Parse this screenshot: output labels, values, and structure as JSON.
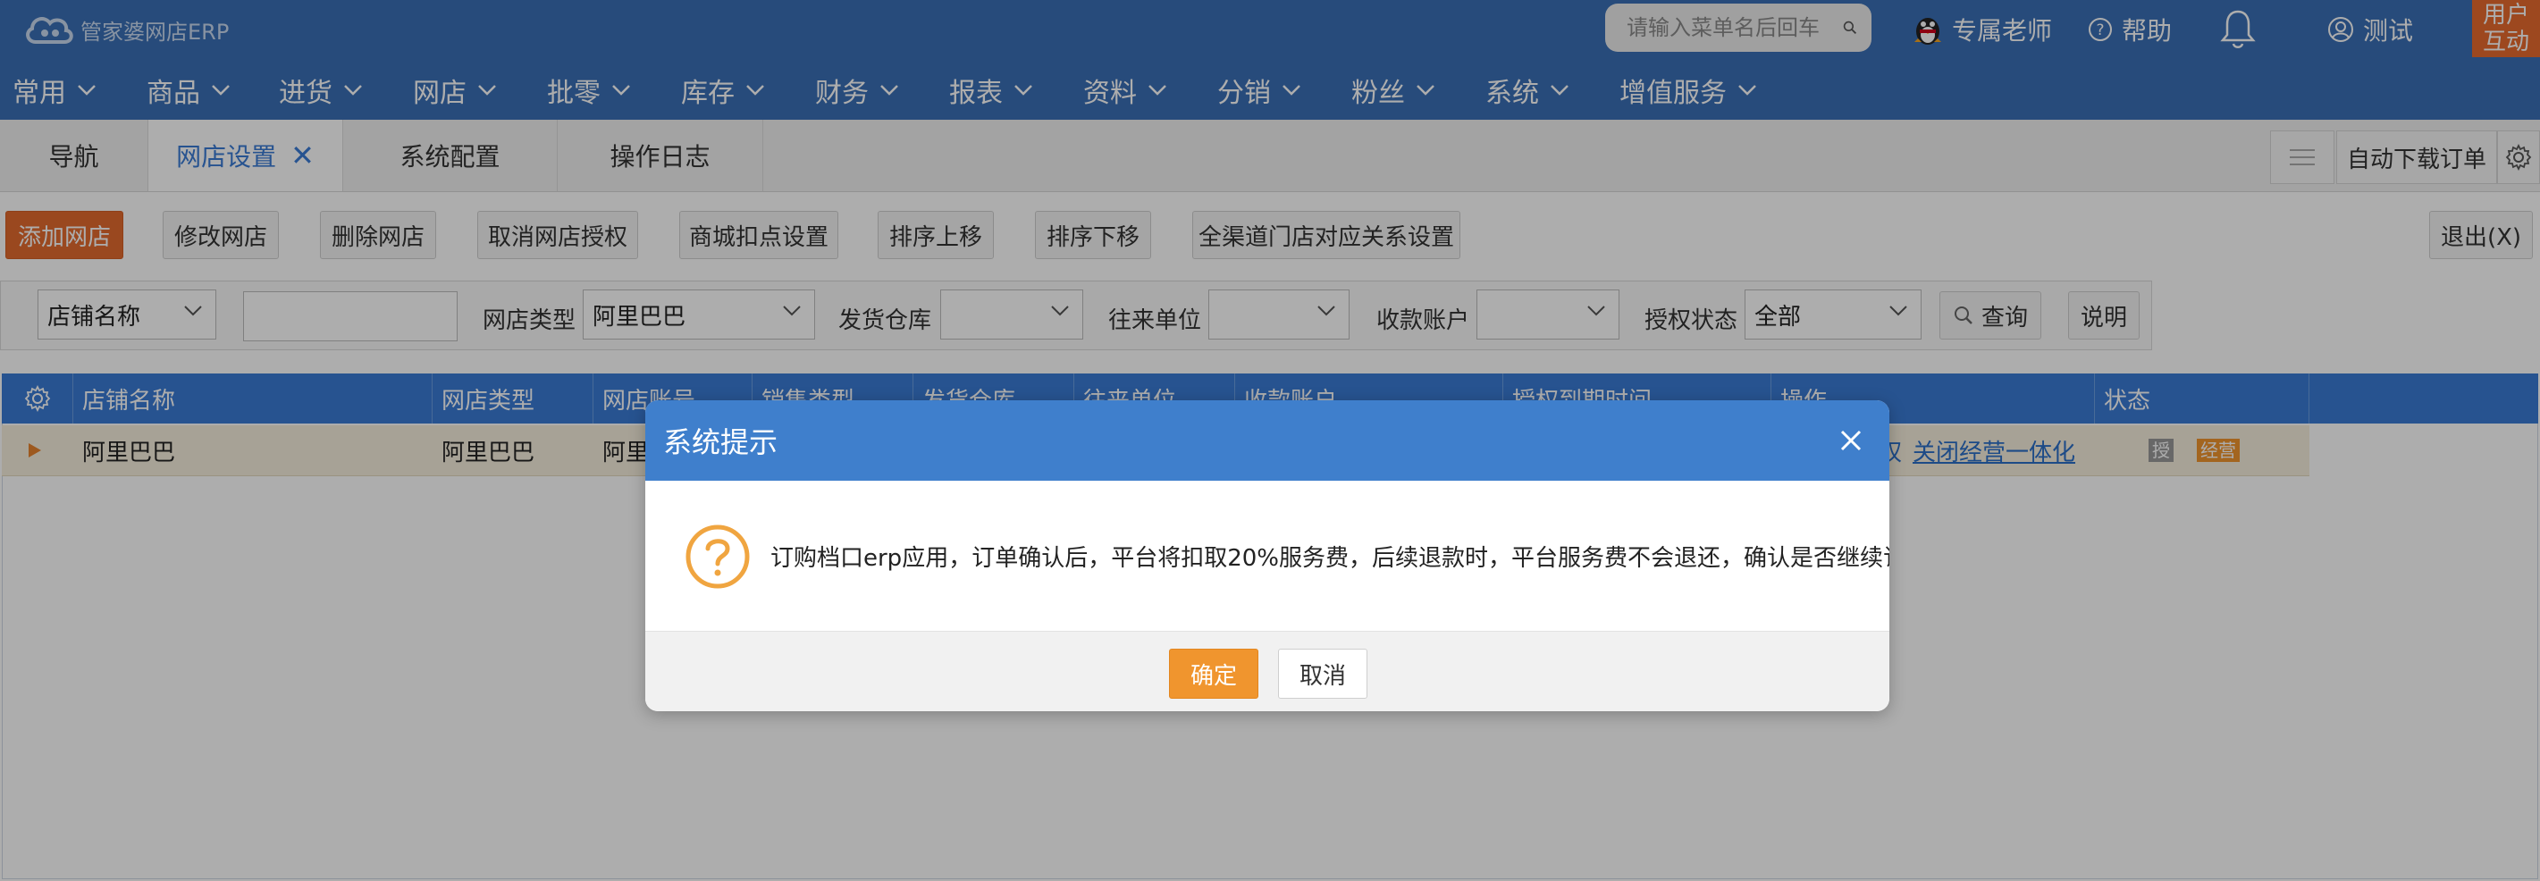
{
  "header": {
    "logo_text": "管家婆网店ERP",
    "search_placeholder": "请输入菜单名后回车",
    "teacher_label": "专属老师",
    "help_label": "帮助",
    "user_label": "测试",
    "user_interact_line1": "用户",
    "user_interact_line2": "互动"
  },
  "menu": [
    "常用",
    "商品",
    "进货",
    "网店",
    "批零",
    "库存",
    "财务",
    "报表",
    "资料",
    "分销",
    "粉丝",
    "系统",
    "增值服务"
  ],
  "tabs": {
    "nav": "导航",
    "store_settings": "网店设置",
    "system_config": "系统配置",
    "op_log": "操作日志",
    "auto_download": "自动下载订单"
  },
  "toolbar": {
    "add_store": "添加网店",
    "edit_store": "修改网店",
    "delete_store": "删除网店",
    "cancel_auth": "取消网店授权",
    "mall_deduction": "商城扣点设置",
    "move_up": "排序上移",
    "move_down": "排序下移",
    "channel_mapping": "全渠道门店对应关系设置",
    "exit": "退出(X)"
  },
  "filter": {
    "field_select": "店铺名称",
    "store_type_label": "网店类型",
    "store_type_value": "阿里巴巴",
    "warehouse_label": "发货仓库",
    "unit_label": "往来单位",
    "account_label": "收款账户",
    "auth_label": "授权状态",
    "auth_value": "全部",
    "query": "查询",
    "explain": "说明"
  },
  "grid": {
    "columns": [
      "店铺名称",
      "网店类型",
      "网店账号",
      "销售类型",
      "发货仓库",
      "往来单位",
      "收款账户",
      "授权到期时间",
      "操作",
      "状态"
    ],
    "row": {
      "store_name": "阿里巴巴",
      "store_type": "阿里巴巴",
      "account_partial": "阿里",
      "op_partial": "权",
      "op_link": "关闭经营一体化",
      "badge_auth": "授",
      "badge_business": "经营"
    }
  },
  "dialog": {
    "title": "系统提示",
    "message": "订购档口erp应用，订单确认后，平台将扣取20%服务费，后续退款时，平台服务费不会退还，确认是否继续订购？",
    "ok": "确定",
    "cancel": "取消"
  },
  "colors": {
    "header_blue": "#3a6fb5",
    "grid_blue": "#3a7bd5",
    "dialog_blue": "#3f7fcc",
    "primary_orange": "#e36a2e",
    "ok_orange": "#f0952e",
    "question_icon": "#f0a540"
  }
}
